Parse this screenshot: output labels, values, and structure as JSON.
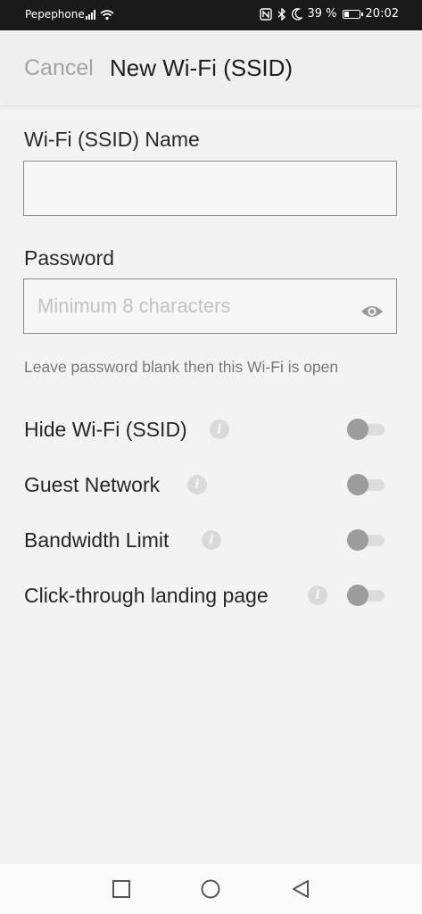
{
  "status_bar": {
    "carrier": "Pepephone",
    "battery": "39 %",
    "battery_level": 0.39,
    "time": "20:02"
  },
  "header": {
    "cancel_label": "Cancel",
    "title": "New Wi-Fi (SSID)"
  },
  "form": {
    "ssid_label": "Wi-Fi (SSID) Name",
    "ssid_value": "",
    "password_label": "Password",
    "password_value": "",
    "password_placeholder": "Minimum 8 characters",
    "password_hint": "Leave password blank then this Wi-Fi is open"
  },
  "options": [
    {
      "label": "Hide Wi-Fi (SSID)",
      "enabled": false
    },
    {
      "label": "Guest Network",
      "enabled": false
    },
    {
      "label": "Bandwidth Limit",
      "enabled": false
    },
    {
      "label": "Click-through landing page",
      "enabled": false
    }
  ],
  "info_glyph": "i",
  "icons": {
    "eye": "eye-icon",
    "info": "info-icon",
    "nav_recents": "square-icon",
    "nav_home": "circle-icon",
    "nav_back": "triangle-back-icon"
  },
  "colors": {
    "background": "#f3f3f3",
    "status_bar": "#1a1a1a",
    "toggle_off_thumb": "#9c9c9c",
    "toggle_off_track": "#dcdcdc",
    "muted_text": "#a4a4a4"
  }
}
